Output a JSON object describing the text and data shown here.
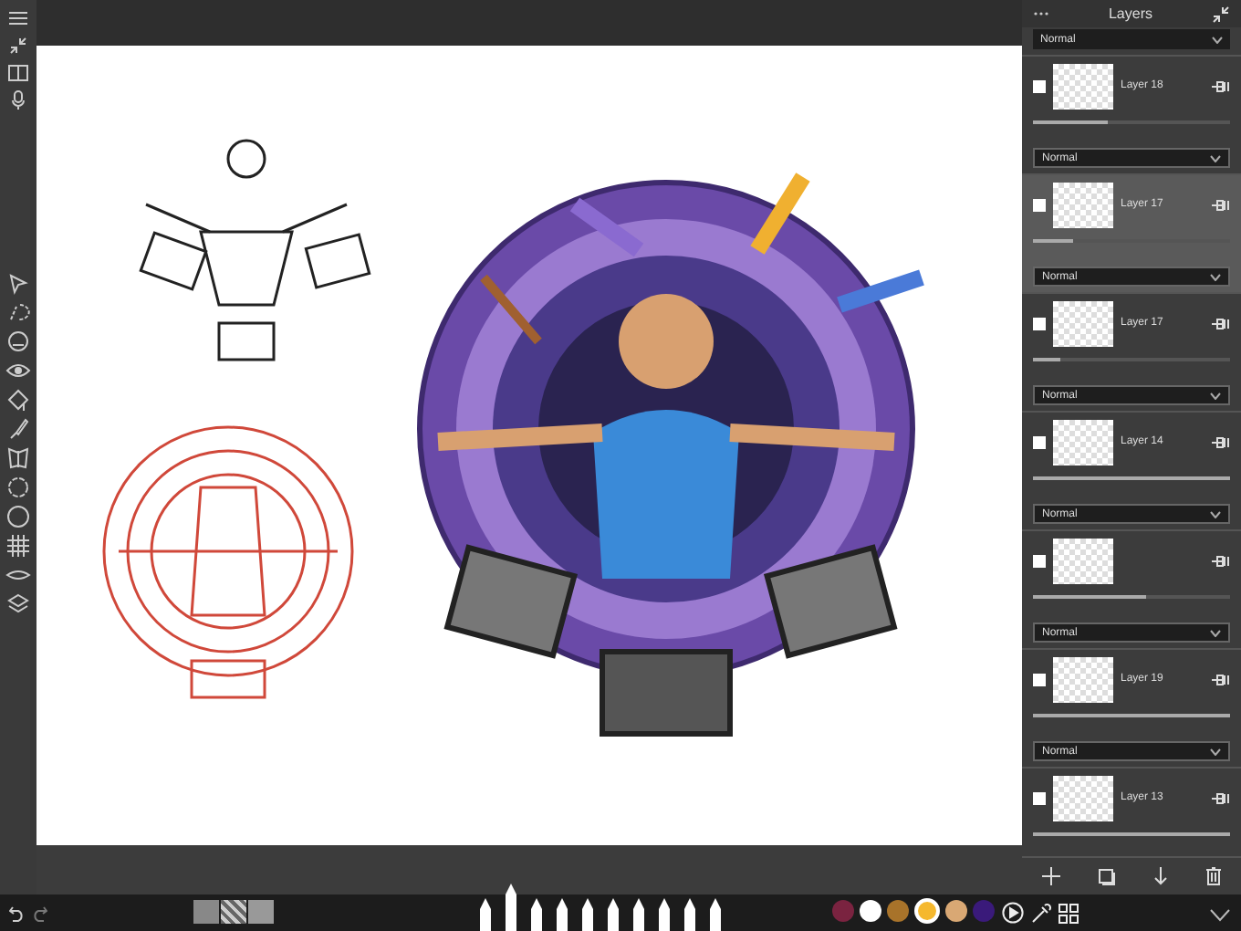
{
  "panel": {
    "title": "Layers",
    "top_blend_mode": "Normal"
  },
  "layers": [
    {
      "name": "Layer 18",
      "selected": false,
      "level": 0.38,
      "blend_mode": "Normal"
    },
    {
      "name": "Layer 17",
      "selected": true,
      "level": 0.2,
      "blend_mode": "Normal"
    },
    {
      "name": "Layer 17",
      "selected": false,
      "level": 0.14,
      "blend_mode": "Normal"
    },
    {
      "name": "Layer 14",
      "selected": false,
      "level": 1,
      "blend_mode": "Normal"
    },
    {
      "selected": false,
      "level": 0.57,
      "blend_mode": "Normal"
    },
    {
      "name": "Layer 19",
      "selected": false,
      "level": 1,
      "blend_mode": "Normal"
    },
    {
      "name": "Layer 13",
      "selected": false,
      "level": 1
    }
  ],
  "brushes": [
    {
      "selected": false
    },
    {
      "selected": true
    },
    {
      "selected": false
    },
    {
      "selected": false
    },
    {
      "selected": false
    },
    {
      "selected": false
    },
    {
      "selected": false
    },
    {
      "selected": false
    },
    {
      "selected": false
    },
    {
      "selected": false
    }
  ],
  "colors": [
    {
      "color": "#7a2340",
      "selected": false
    },
    {
      "color": "#ffffff",
      "selected": false
    },
    {
      "color": "#a8732a",
      "selected": false
    },
    {
      "color": "#f5b82e",
      "selected": true
    },
    {
      "color": "#d9a874",
      "selected": false
    },
    {
      "color": "#3a1a7a",
      "selected": false
    }
  ]
}
